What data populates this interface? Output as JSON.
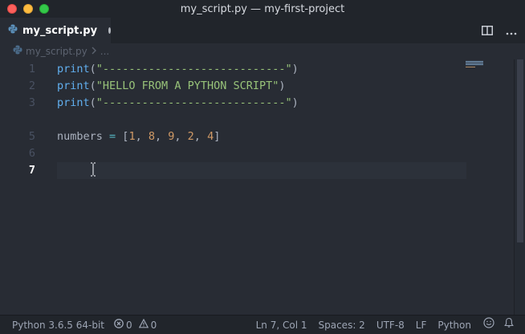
{
  "window": {
    "title": "my_script.py — my-first-project"
  },
  "tab": {
    "label": "my_script.py"
  },
  "breadcrumb": {
    "file": "my_script.py",
    "more": "..."
  },
  "editor": {
    "line_numbers": [
      "1",
      "2",
      "3",
      "5",
      "6",
      "7"
    ],
    "active_line": "7",
    "lines": [
      {
        "fn": "print",
        "open": "(",
        "str": "\"----------------------------\"",
        "close": ")"
      },
      {
        "fn": "print",
        "open": "(",
        "str": "\"HELLO FROM A PYTHON SCRIPT\"",
        "close": ")"
      },
      {
        "fn": "print",
        "open": "(",
        "str": "\"----------------------------\"",
        "close": ")"
      }
    ],
    "numbers_line": {
      "name": "numbers",
      "eq": " = ",
      "open": "[",
      "values": [
        "1",
        "8",
        "9",
        "2",
        "4"
      ],
      "close": "]"
    }
  },
  "statusbar": {
    "interpreter": "Python 3.6.5 64-bit",
    "errors": "0",
    "warnings": "0",
    "position": "Ln 7, Col 1",
    "indent": "Spaces: 2",
    "encoding": "UTF-8",
    "eol": "LF",
    "language": "Python"
  }
}
